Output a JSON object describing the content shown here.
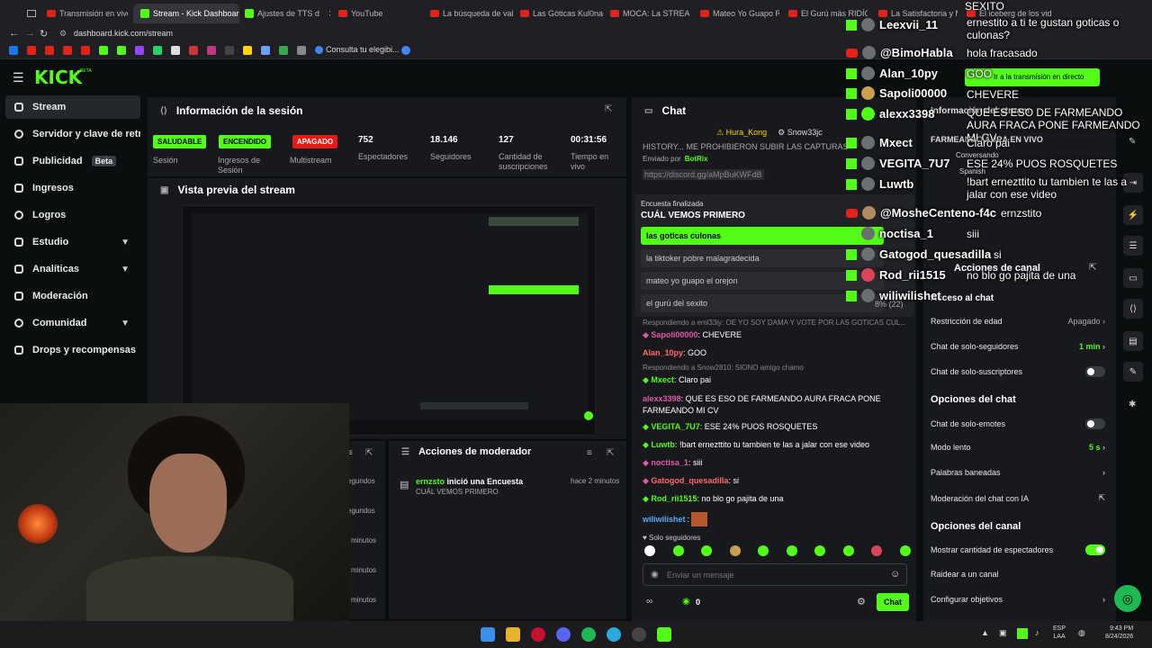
{
  "tabs": [
    {
      "label": "Transmisión en vivo"
    },
    {
      "label": "Stream - Kick Dashboard"
    },
    {
      "label": "Ajustes de TTS d"
    },
    {
      "label": "YouTube"
    },
    {
      "label": "La búsqueda de valo"
    },
    {
      "label": "Las Góticas Kul0nas"
    },
    {
      "label": "MOCA: La STREAMER"
    },
    {
      "label": "Mateo Yo Guapo REG"
    },
    {
      "label": "El Gurú más RIDÍCU"
    },
    {
      "label": "La Satisfactoria y M"
    },
    {
      "label": "El iceberg de los vide"
    }
  ],
  "address": {
    "url": "dashboard.kick.com/stream"
  },
  "bookmarks": {
    "label": "Consulta tu elegibi..."
  },
  "header": {
    "logo": "KICK",
    "logo_tag": "BETA"
  },
  "sidebar": {
    "items": [
      {
        "label": "Stream"
      },
      {
        "label": "Servidor y clave de retran"
      },
      {
        "label": "Publicidad",
        "badge": "Beta"
      },
      {
        "label": "Ingresos"
      },
      {
        "label": "Logros"
      },
      {
        "label": "Estudio"
      },
      {
        "label": "Analíticas"
      },
      {
        "label": "Moderación"
      },
      {
        "label": "Comunidad"
      },
      {
        "label": "Drops y recompensas"
      }
    ]
  },
  "session": {
    "title": "Información de la sesión",
    "stats": [
      {
        "value": "SALUDABLE",
        "label": "Sesión"
      },
      {
        "value": "ENCENDIDO",
        "label": "Ingresos de Sesión"
      },
      {
        "value": "APAGADO",
        "label": "Multistream"
      },
      {
        "value": "752",
        "label": "Espectadores"
      },
      {
        "value": "18.146",
        "label": "Seguidores"
      },
      {
        "value": "127",
        "label": "Cantidad de suscripciones"
      },
      {
        "value": "00:31:56",
        "label": "Tiempo en vivo"
      }
    ]
  },
  "preview": {
    "title": "Vista previa del stream"
  },
  "activity": {
    "times": [
      "egundos",
      "egundos",
      "minutos",
      "minutos",
      "minutos"
    ]
  },
  "modactions": {
    "title": "Acciones de moderador",
    "item": {
      "user": "ernzsto",
      "action": "inició una Encuesta",
      "detail": "CUÁL VEMOS PRIMERO",
      "time": "hace 2 minutos"
    }
  },
  "chat": {
    "title": "Chat",
    "pinned_users": [
      "Hura_Kong",
      "Snow33jc"
    ],
    "history": "HISTORY... ME PROHIBIERON SUBIR LAS CAPTURAS",
    "sent_by": "Enviado por",
    "bot": "BotRix",
    "link": "https://discord.gg/aMpBuKWFdB",
    "poll": {
      "status": "Encuesta finalizada",
      "question": "CUÁL VEMOS PRIMERO",
      "options": [
        "las goticas culonas",
        "la tiktoker pobre malagradecida",
        "mateo yo guapo el orejon",
        "el gurú del sexito"
      ],
      "winner_votes": "8% (22)"
    },
    "reply1": "Respondiendo a eml33iy: OE YO SOY DAMA Y VOTE POR LAS GOTICAS CUL...",
    "messages": [
      {
        "user": "Sapoli00000",
        "text": "CHEVERE",
        "color": "#e05aa8"
      },
      {
        "user": "Alan_10py",
        "text": "GOO",
        "color": "#ff6b6b"
      },
      {
        "reply": "Respondiendo a Snow2810: SIONO amigo chamo"
      },
      {
        "user": "Mxect",
        "text": "Claro pai",
        "color": "#53fc18"
      },
      {
        "user": "alexx3398",
        "text": "QUE ES ESO DE FARMEANDO AURA FRACA PONE FARMEANDO MI CV",
        "color": "#e05aa8"
      },
      {
        "user": "VEGITA_7U7",
        "text": "ESE 24% PUOS ROSQUETES",
        "color": "#53fc18"
      },
      {
        "user": "Luwtb",
        "text": "!bart ernezttito tu tambien te las a jalar con ese video",
        "color": "#53fc18"
      },
      {
        "user": "noctisa_1",
        "text": "siii",
        "color": "#e05aa8"
      },
      {
        "user": "Gatogod_quesadilla",
        "text": "si",
        "color": "#ff6b6b"
      },
      {
        "user": "Rod_rii1515",
        "text": "no blo go pajita de una",
        "color": "#53fc18"
      },
      {
        "user": "wiliwilishet",
        "text": "",
        "color": "#5aa8ff"
      }
    ],
    "mode": "Solo seguidores",
    "placeholder": "Enviar un mensaje",
    "count": "0",
    "send": "Chat"
  },
  "overlay": {
    "top_text": "SEXITO",
    "rows": [
      {
        "user": "Leexvii_11",
        "msg": "ernestito a ti te gustan goticas o culonas?",
        "platform": "kick"
      },
      {
        "user": "@BimoHabla",
        "msg": "hola fracasado",
        "platform": "youtube"
      },
      {
        "user": "Alan_10py",
        "msg": "GOO",
        "platform": "kick"
      },
      {
        "user": "Sapoli00000",
        "msg": "CHEVERE",
        "platform": "kick"
      },
      {
        "user": "alexx3398",
        "msg": "QUE ES ESO DE FARMEANDO AURA FRACA PONE FARMEANDO MI CV",
        "platform": "kick"
      },
      {
        "user": "Mxect",
        "msg": "Claro pai",
        "platform": "kick"
      },
      {
        "user": "VEGITA_7U7",
        "msg": "ESE 24% PUOS ROSQUETES",
        "platform": "kick"
      },
      {
        "user": "Luwtb",
        "msg": "!bart ernezttito tu tambien te las a jalar con ese video",
        "platform": "kick"
      },
      {
        "user": "@MosheCenteno-f4c",
        "msg": "ernzstito",
        "platform": "youtube"
      },
      {
        "user": "noctisa_1",
        "msg": "siii",
        "platform": "kick"
      },
      {
        "user": "Gatogod_quesadilla",
        "msg": "si",
        "platform": "kick"
      },
      {
        "user": "Rod_rii1515",
        "msg": "no blo go pajita de una",
        "platform": "kick"
      },
      {
        "user": "wiliwilishet",
        "msg": "",
        "platform": "kick"
      }
    ],
    "live_btn": "Ir a la transmisión en directo",
    "conversando": "Conversando",
    "spanish": "Spanish"
  },
  "settings": {
    "session_info": "Información del stream",
    "title_text": "FARMEANDO AURA EN VIVO",
    "channel_actions": "Acciones de canal",
    "chat_access": "Acceso al chat",
    "rows": [
      {
        "label": "Restricción de edad",
        "value": "Apagado"
      },
      {
        "label": "Chat de solo-seguidores",
        "value": "1 min"
      },
      {
        "label": "Chat de solo-suscriptores",
        "value": ""
      }
    ],
    "chat_options": "Opciones del chat",
    "chat_rows": [
      {
        "label": "Chat de solo-emotes",
        "value": ""
      },
      {
        "label": "Modo lento",
        "value": "5 s"
      },
      {
        "label": "Palabras baneadas",
        "value": ""
      },
      {
        "label": "Moderación del chat con IA",
        "value": ""
      }
    ],
    "channel_options": "Opciones del canal",
    "channel_rows": [
      {
        "label": "Mostrar cantidad de espectadores",
        "value": ""
      },
      {
        "label": "Raidear a un canal",
        "value": ""
      },
      {
        "label": "Configurar objetivos",
        "value": ""
      }
    ]
  },
  "taskbar": {
    "lang1": "ESP",
    "lang2": "LAA",
    "time": "9:43 PM",
    "date": "8/24/2026"
  }
}
